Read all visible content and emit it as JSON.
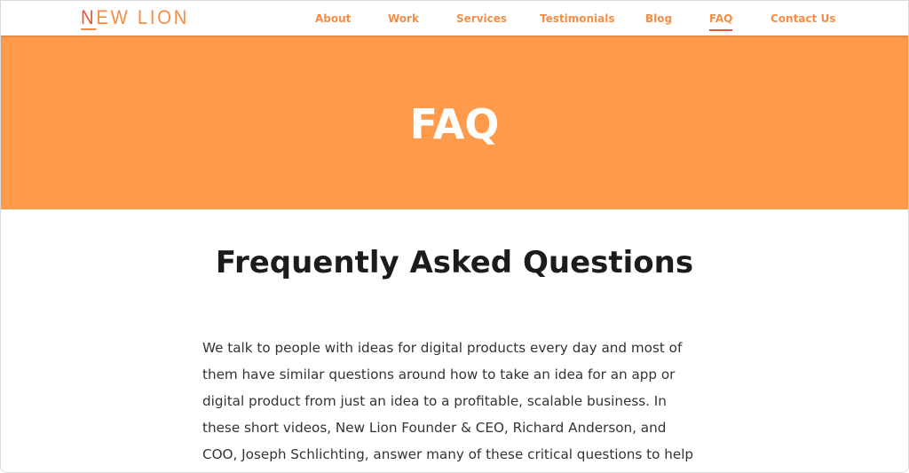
{
  "brand": {
    "logo_first_letter": "N",
    "logo_rest": "EW LION",
    "accent": "#f58d45",
    "hero_bg": "#fe9a4a"
  },
  "nav": {
    "items": [
      {
        "label": "About",
        "active": false
      },
      {
        "label": "Work",
        "active": false
      },
      {
        "label": "Services",
        "active": false
      },
      {
        "label": "Testimonials",
        "active": false
      },
      {
        "label": "Blog",
        "active": false
      },
      {
        "label": "FAQ",
        "active": true
      },
      {
        "label": "Contact Us",
        "active": false
      }
    ]
  },
  "hero": {
    "title": "FAQ"
  },
  "main": {
    "heading": "Frequently Asked Questions",
    "intro_lines": [
      "We talk to people with ideas for digital products every day and most of",
      "them have similar questions around how to take an idea for an app or",
      "digital product from just an idea to a profitable, scalable business. In",
      "these short videos, New Lion Founder & CEO, Richard Anderson, and",
      "COO, Joseph Schlichting, answer many of these critical questions to help"
    ]
  }
}
